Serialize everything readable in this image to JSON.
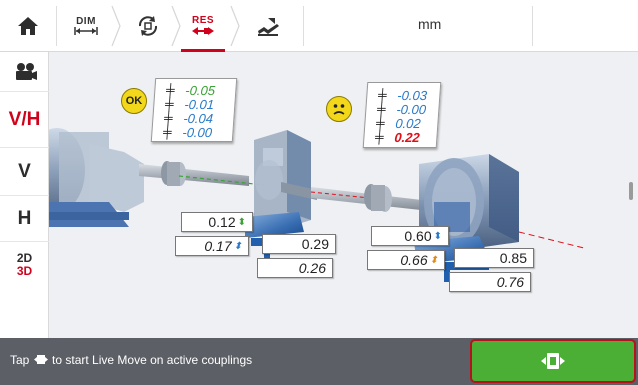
{
  "toolbar": {
    "dim_label": "DIM",
    "res_label": "RES",
    "unit": "mm",
    "icons": [
      "home-icon",
      "dim-icon",
      "rotate-icon",
      "res-icon",
      "machine-edit-icon"
    ]
  },
  "sidebar": {
    "items": [
      {
        "icon": "camera-view-icon"
      },
      {
        "label": "V/H",
        "active": true
      },
      {
        "label": "V"
      },
      {
        "label": "H"
      },
      {
        "label_top": "2D",
        "label_bottom": "3D"
      }
    ]
  },
  "couplings": [
    {
      "status": "OK",
      "results": [
        "-0.05",
        "-0.01",
        "-0.04",
        "-0.00"
      ],
      "colors": [
        "#3aa335",
        "#2a7bc9",
        "#2a7bc9",
        "#2a7bc9"
      ]
    },
    {
      "status": "warning",
      "results": [
        "-0.03",
        "-0.00",
        "0.02",
        "0.22"
      ],
      "colors": [
        "#2a7bc9",
        "#2a7bc9",
        "#2a7bc9",
        "#e0101a"
      ]
    }
  ],
  "feet": {
    "gearbox": {
      "front_vertical": "0.12",
      "front_horizontal": "0.17",
      "rear_vertical": "0.29",
      "rear_horizontal": "0.26"
    },
    "motor": {
      "front_vertical": "0.60",
      "front_horizontal": "0.66",
      "rear_vertical": "0.85",
      "rear_horizontal": "0.76"
    }
  },
  "status": {
    "text_before": "Tap",
    "text_after": "to start Live Move on active couplings",
    "icon": "live-move-icon"
  },
  "colors": {
    "accent": "#d0021b",
    "ok_green": "#4caf35",
    "machine_blue": "#1f5fae"
  }
}
